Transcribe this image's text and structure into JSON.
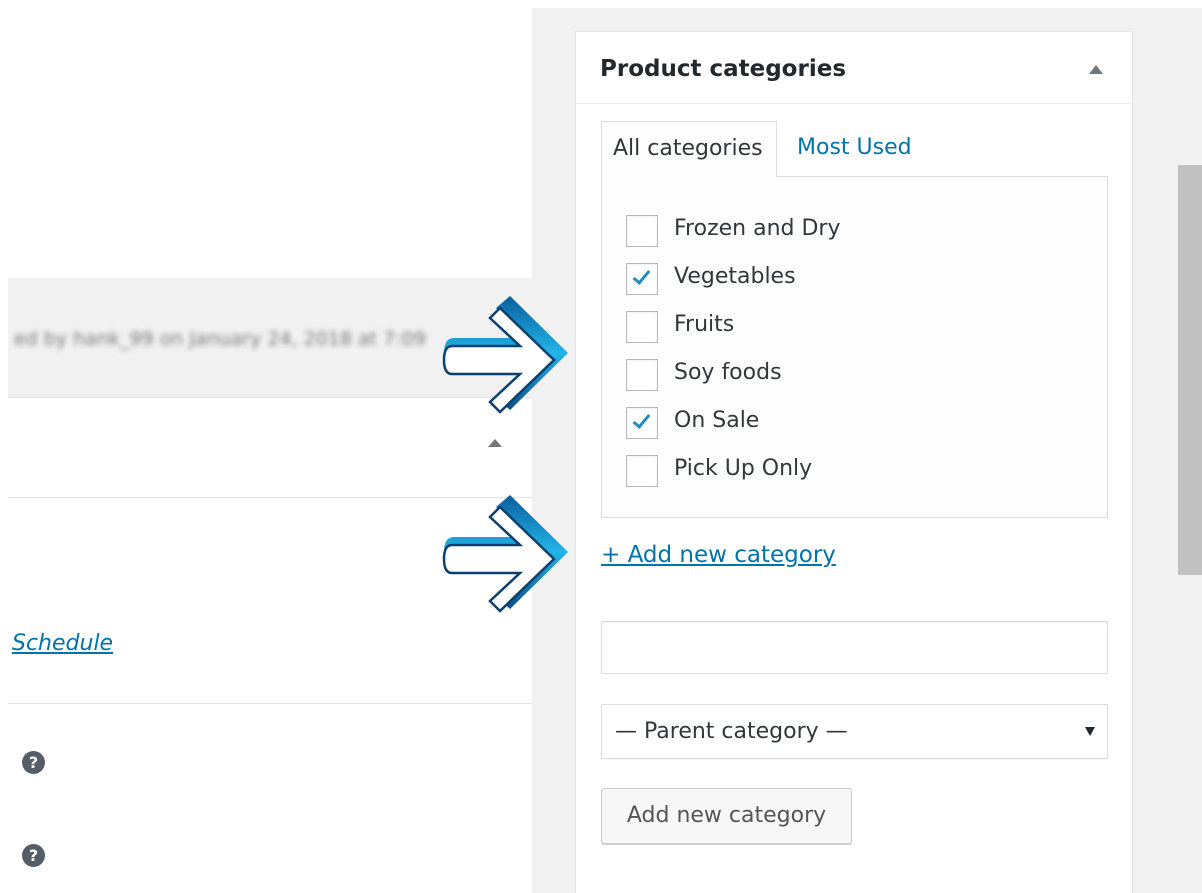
{
  "left": {
    "blurred_text": "ed by hank_99 on January 24, 2018 at 7:09",
    "schedule_link": "Schedule",
    "help_icon_glyph": "?"
  },
  "panel": {
    "title": "Product categories",
    "tabs": [
      {
        "label": "All categories",
        "active": true
      },
      {
        "label": "Most Used",
        "active": false
      }
    ],
    "categories": [
      {
        "label": "Frozen and Dry",
        "checked": false
      },
      {
        "label": "Vegetables",
        "checked": true
      },
      {
        "label": "Fruits",
        "checked": false
      },
      {
        "label": "Soy foods",
        "checked": false
      },
      {
        "label": "On Sale",
        "checked": true
      },
      {
        "label": "Pick Up Only",
        "checked": false
      }
    ],
    "add_new_link": "+ Add new category",
    "new_category_value": "",
    "parent_select": "— Parent category —",
    "add_button": "Add new category"
  },
  "colors": {
    "link": "#0073aa",
    "check": "#1e8cbe",
    "arrow_fill": "#1ca3d8"
  }
}
